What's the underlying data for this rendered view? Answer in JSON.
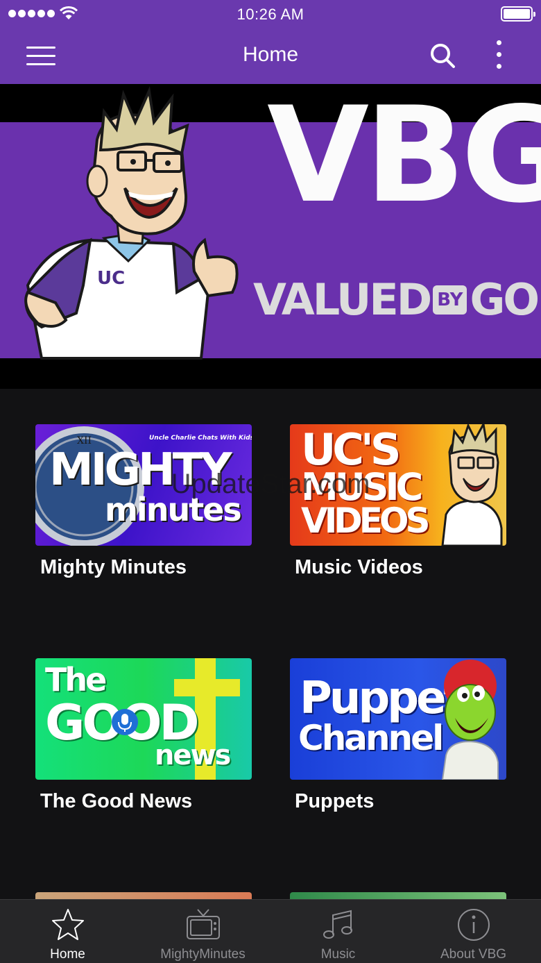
{
  "status_bar": {
    "time": "10:26 AM"
  },
  "nav": {
    "title": "Home"
  },
  "banner": {
    "logo_text": "VBG",
    "tagline_left": "VALUED",
    "tagline_by": "BY",
    "tagline_right": "GOD",
    "shirt_logo": "UC"
  },
  "tiles": [
    {
      "caption": "Mighty Minutes",
      "thumb_top": "Uncle Charlie Chats With Kids",
      "thumb_line1": "MIGHTY",
      "thumb_line2": "minutes"
    },
    {
      "caption": "Music Videos",
      "thumb_line1": "UC'S",
      "thumb_line2": "MUSIC",
      "thumb_line3": "VIDEOS"
    },
    {
      "caption": "The Good News",
      "thumb_line1": "The",
      "thumb_line2": "GOOD",
      "thumb_line3": "news"
    },
    {
      "caption": "Puppets",
      "thumb_line1": "Puppet",
      "thumb_line2": "Channel"
    }
  ],
  "watermark": "UpdateStar.com",
  "tab_bar": {
    "items": [
      {
        "label": "Home",
        "icon": "star-icon",
        "active": true
      },
      {
        "label": "MightyMinutes",
        "icon": "tv-icon",
        "active": false
      },
      {
        "label": "Music",
        "icon": "music-note-icon",
        "active": false
      },
      {
        "label": "About VBG",
        "icon": "info-icon",
        "active": false
      }
    ]
  },
  "colors": {
    "brand_purple": "#6a39ae",
    "background": "#121214",
    "tab_bar": "#262628",
    "tab_inactive": "#8e8e92"
  }
}
